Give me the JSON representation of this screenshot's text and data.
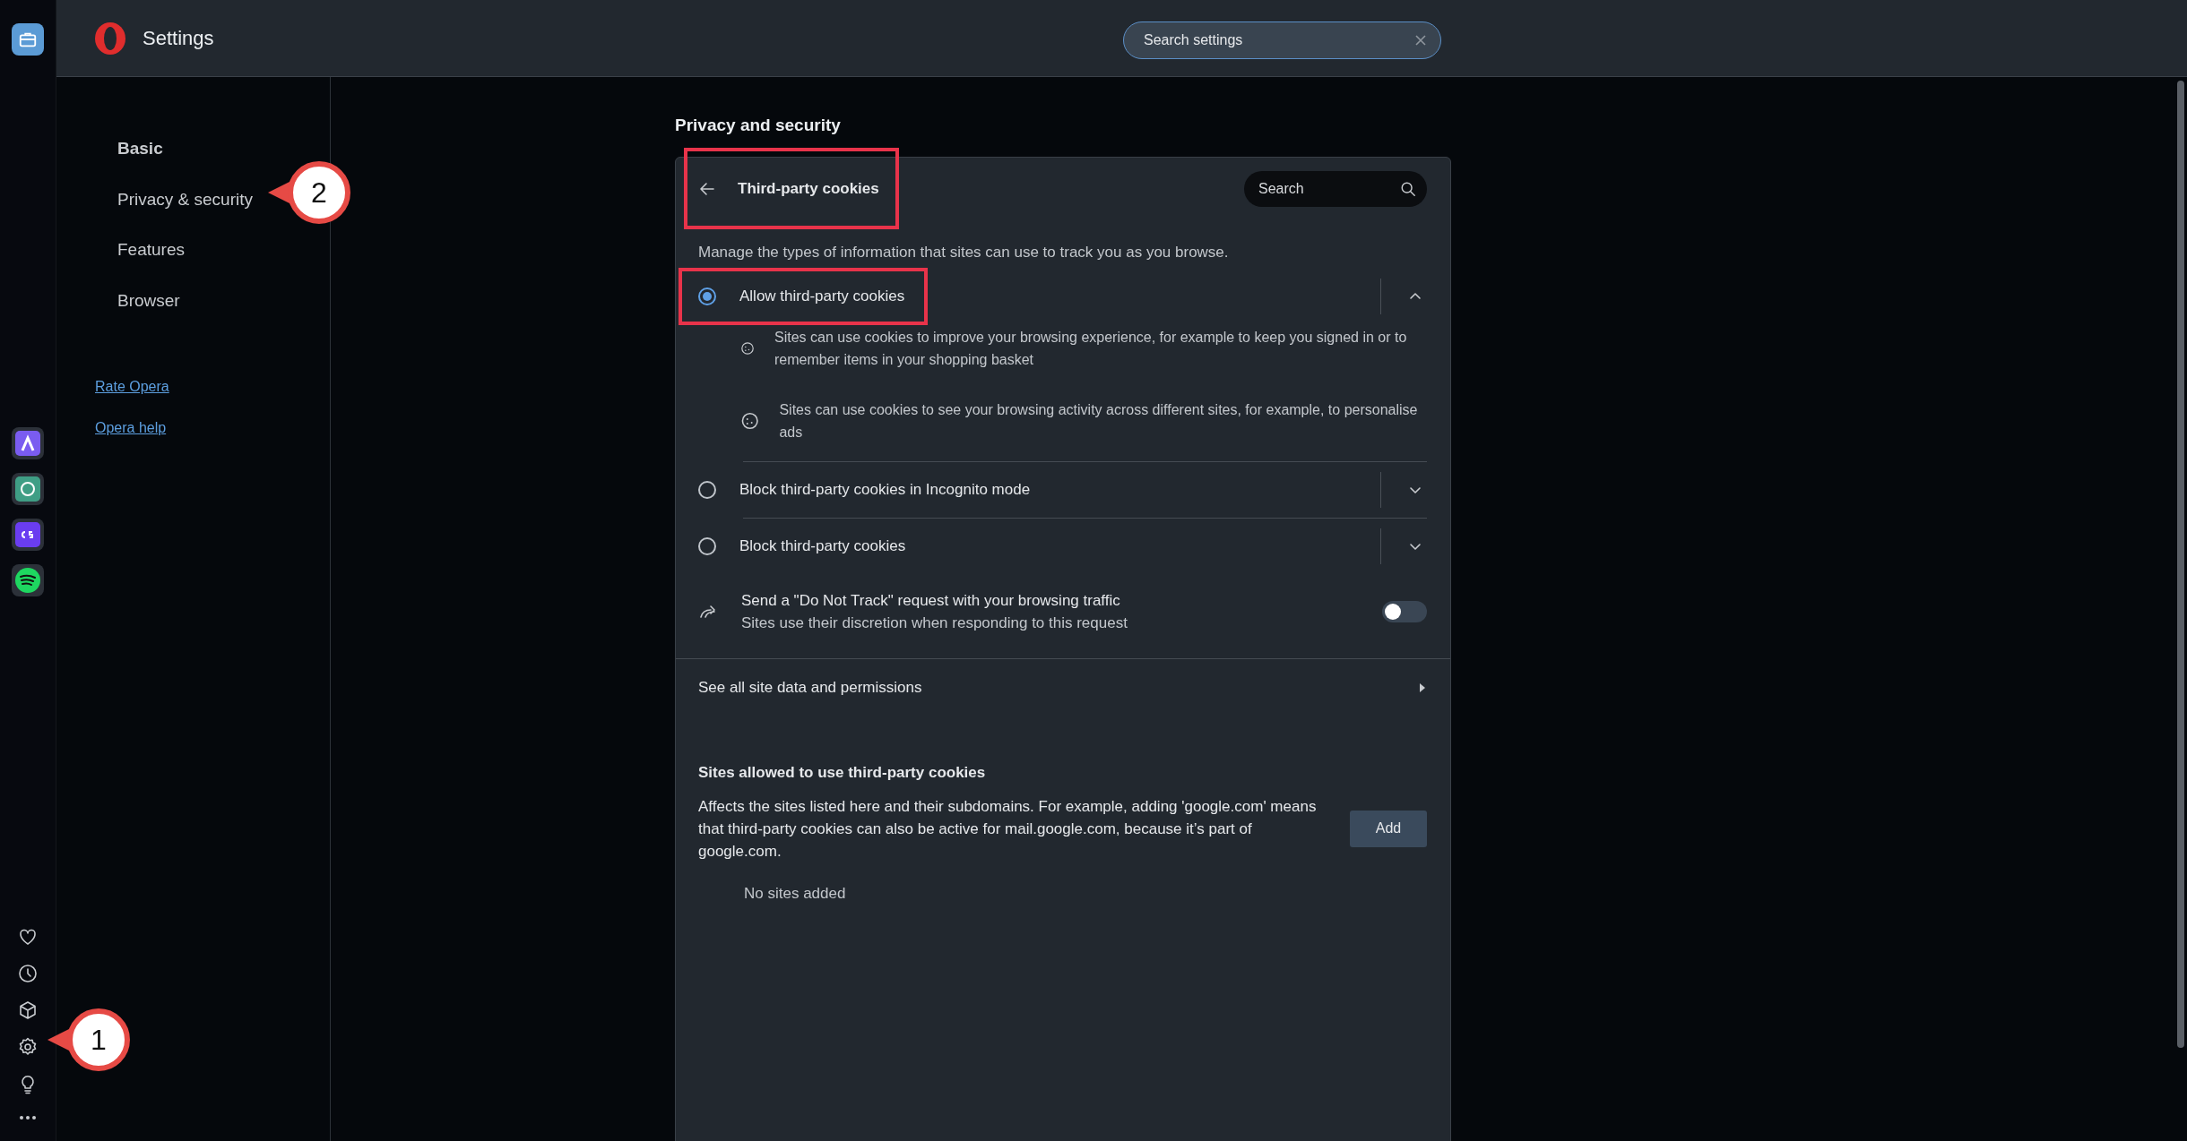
{
  "header": {
    "title": "Settings",
    "search": {
      "placeholder": "Search settings"
    }
  },
  "nav": {
    "items": [
      {
        "label": "Basic",
        "selected": true
      },
      {
        "label": "Privacy & security",
        "selected": false
      },
      {
        "label": "Features",
        "selected": false
      },
      {
        "label": "Browser",
        "selected": false
      }
    ],
    "links": [
      "Rate Opera",
      "Opera help"
    ]
  },
  "section_title": "Privacy and security",
  "card": {
    "title": "Third-party cookies",
    "title_highlighted": true,
    "search": {
      "placeholder": "Search"
    },
    "description": "Manage the types of information that sites can use to track you as you browse.",
    "options": [
      {
        "label": "Allow third-party cookies",
        "selected": true,
        "expanded": true,
        "highlighted": true,
        "details": [
          "Sites can use cookies to improve your browsing experience, for example to keep you signed in or to remember items in your shopping basket",
          "Sites can use cookies to see your browsing activity across different sites, for example, to personalise ads"
        ]
      },
      {
        "label": "Block third-party cookies in Incognito mode",
        "selected": false,
        "expanded": false,
        "highlighted": false
      },
      {
        "label": "Block third-party cookies",
        "selected": false,
        "expanded": false,
        "highlighted": false
      }
    ],
    "do_not_track": {
      "title": "Send a \"Do Not Track\" request with your browsing traffic",
      "subtitle": "Sites use their discretion when responding to this request",
      "on": false
    },
    "site_data_link": "See all site data and permissions",
    "allowed": {
      "title": "Sites allowed to use third-party cookies",
      "description": "Affects the sites listed here and their subdomains. For example, adding 'google.com' means that third-party cookies can also be active for mail.google.com, because it’s part of google.com.",
      "add_button": "Add",
      "empty_text": "No sites added"
    }
  },
  "annotations": [
    {
      "number": "1"
    },
    {
      "number": "2"
    }
  ]
}
